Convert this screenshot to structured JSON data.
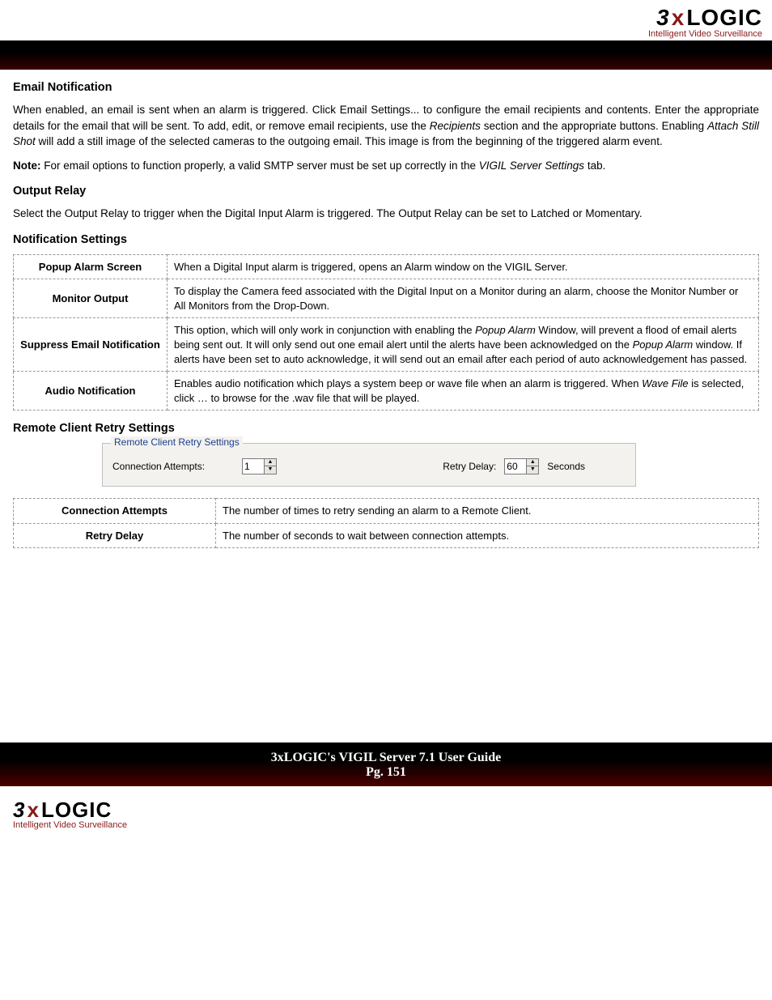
{
  "brand": {
    "prefix": "3",
    "x": "x",
    "suffix": "LOGIC",
    "tagline": "Intelligent Video Surveillance"
  },
  "sections": {
    "email_h": "Email Notification",
    "email_p1a": "When enabled, an email is sent when an alarm is triggered.  Click Email Settings... to configure the email recipients and contents.  Enter the appropriate details for the email that will be sent. To add, edit, or remove email recipients, use the ",
    "email_p1_recipients": "Recipients",
    "email_p1b": " section and the appropriate buttons. Enabling ",
    "email_p1_attach": "Attach Still Shot",
    "email_p1c": " will add a still image of the selected cameras to the outgoing email. This image is from the beginning of the triggered alarm event.",
    "note_label": "Note:",
    "note_a": " For email options to function properly, a valid SMTP server must be set up correctly in the ",
    "note_ital": "VIGIL Server Settings",
    "note_b": " tab.",
    "output_h": "Output Relay",
    "output_p": "Select the Output Relay to trigger when the Digital Input Alarm is triggered.  The Output Relay can be set to Latched or Momentary.",
    "notif_h": "Notification Settings",
    "remote_h": "Remote Client Retry Settings"
  },
  "notif_rows": [
    {
      "label": "Popup Alarm Screen",
      "desc": "When a Digital Input alarm is triggered, opens an Alarm window on the VIGIL Server."
    },
    {
      "label": "Monitor Output",
      "desc": "To display the Camera feed associated with the Digital Input on a Monitor during an alarm, choose the Monitor Number or All Monitors from the Drop-Down."
    },
    {
      "label": "Suppress Email Notification",
      "desc_a": "This option, which will only work in conjunction with enabling the ",
      "desc_ital1": "Popup Alarm",
      "desc_b": " Window, will prevent a flood of email alerts being sent out. It will only send out one email alert until the alerts have been acknowledged on the ",
      "desc_ital2": "Popup Alarm",
      "desc_c": " window. If alerts have been set to auto acknowledge, it will send out an email after each period of auto acknowledgement has passed."
    },
    {
      "label": "Audio Notification",
      "desc_a": "Enables audio notification which plays a system beep or wave file when an alarm is triggered. When ",
      "desc_ital1": "Wave File",
      "desc_b": " is selected, click … to browse for the .wav file that will be played."
    }
  ],
  "fieldset": {
    "legend": "Remote Client Retry Settings",
    "conn_label": "Connection Attempts:",
    "conn_value": "1",
    "retry_label": "Retry Delay:",
    "retry_value": "60",
    "seconds": "Seconds"
  },
  "retry_rows": [
    {
      "label": "Connection Attempts",
      "desc": "The number of times to retry sending an alarm to a Remote Client."
    },
    {
      "label": "Retry Delay",
      "desc": "The number of seconds to wait between connection attempts."
    }
  ],
  "footer": {
    "title": "3xLOGIC's VIGIL Server 7.1 User Guide",
    "page": "Pg. 151"
  }
}
